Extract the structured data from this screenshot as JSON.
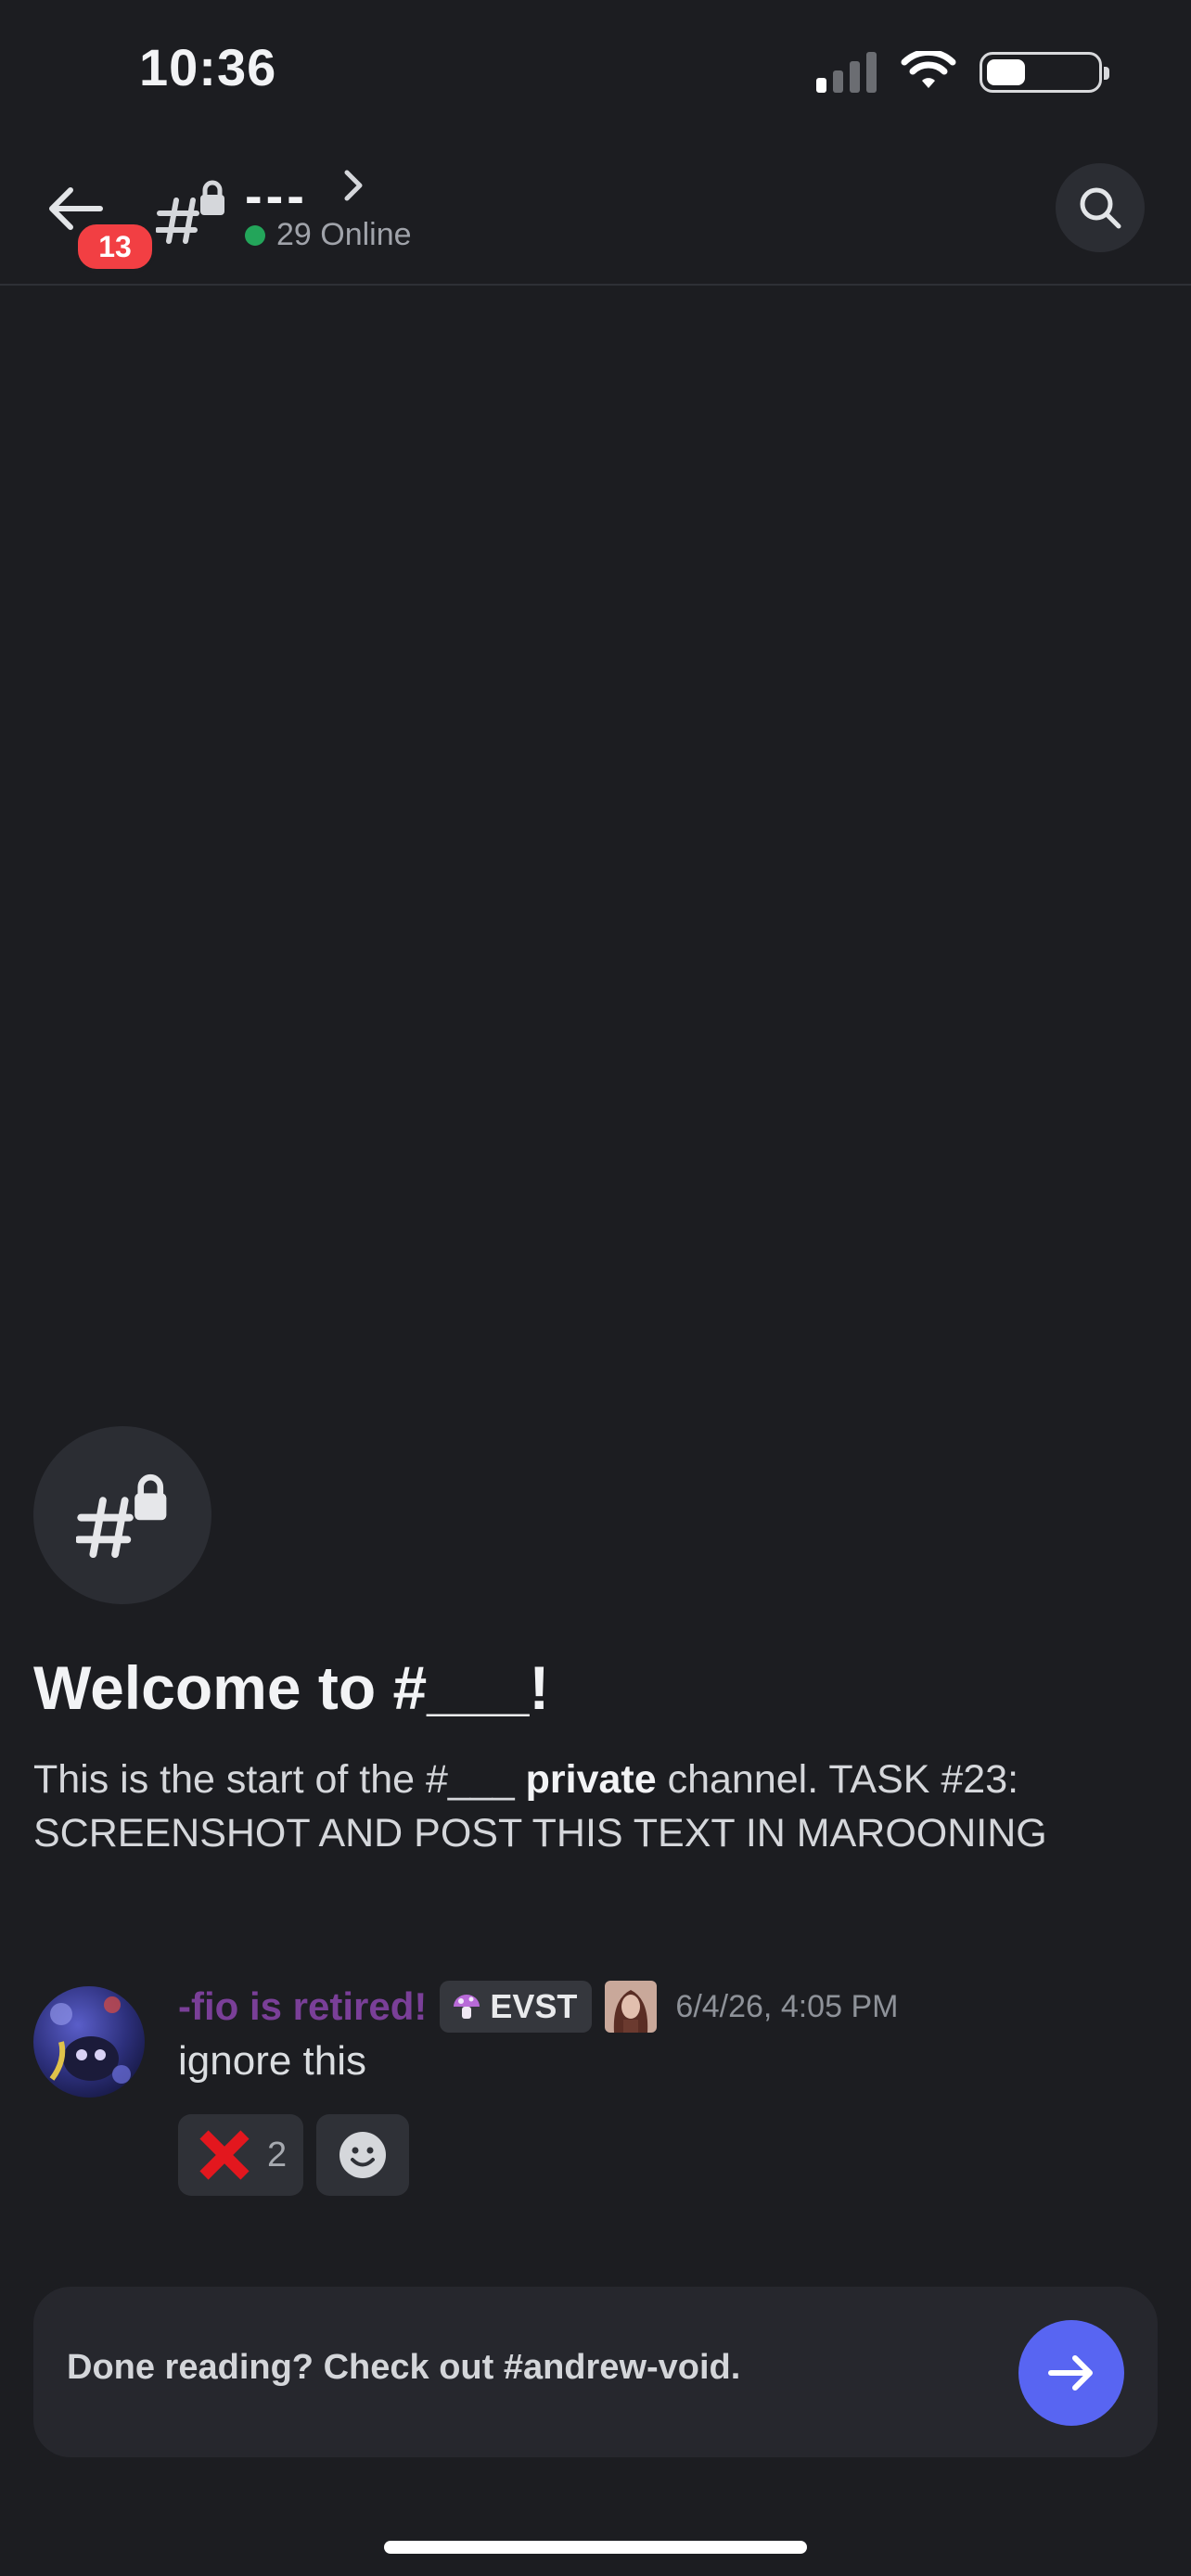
{
  "status_bar": {
    "time": "10:36",
    "icons": [
      "cellular-signal-icon",
      "wifi-icon",
      "battery-icon"
    ],
    "battery_level": 0.35
  },
  "header": {
    "back_icon": "arrow-left-icon",
    "unread_badge": "13",
    "channel_icon": "locked-channel-hash-icon",
    "channel_name": "---",
    "online_text": "29 Online",
    "online_color": "#23a55a",
    "search_icon": "search-icon"
  },
  "welcome": {
    "title": "Welcome to #___!",
    "desc_before": "This is the start of the #___ ",
    "desc_bold": "private",
    "desc_after": " channel. TASK #23: SCREENSHOT AND POST THIS TEXT IN MAROONING"
  },
  "message": {
    "username": "-fio is retired!",
    "username_color": "#7a3f98",
    "role_tag": "EVST",
    "timestamp": "6/4/26, 4:05 PM",
    "text": "ignore this",
    "reactions": [
      {
        "emoji": "cross-mark-icon",
        "count": "2"
      }
    ],
    "add_reaction_icon": "smiley-add-reaction-icon"
  },
  "banner": {
    "text": "Done reading? Check out #andrew-void.",
    "button_icon": "arrow-right-icon",
    "button_color": "#5865f2"
  }
}
